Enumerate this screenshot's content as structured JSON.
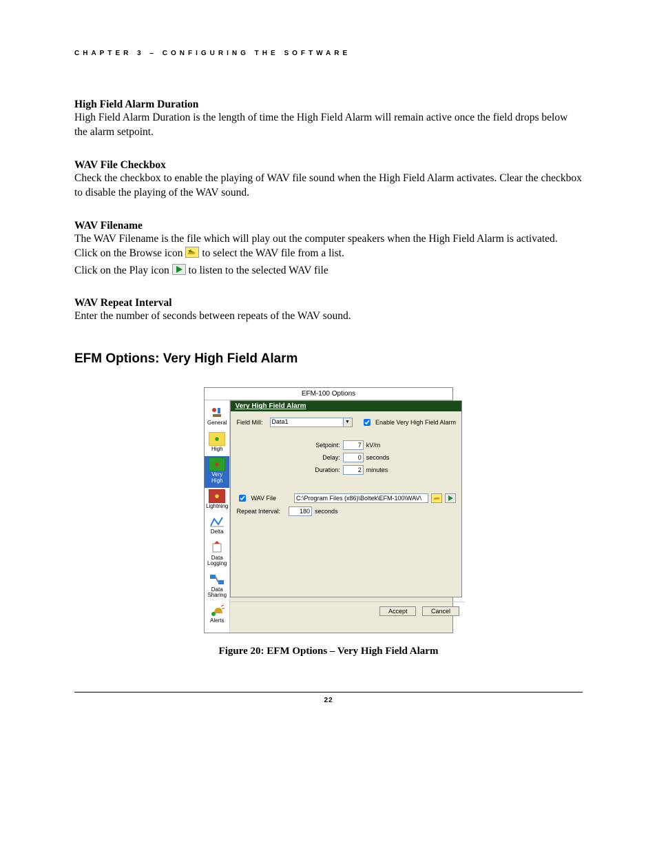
{
  "running_head": "CHAPTER 3 – CONFIGURING THE SOFTWARE",
  "s1": {
    "title": "High Field Alarm Duration",
    "body": "High Field Alarm Duration is the length of time the High Field Alarm will remain active once the field drops below the alarm setpoint."
  },
  "s2": {
    "title": "WAV File Checkbox",
    "body": "Check the checkbox to enable the playing of WAV file sound when the High Field Alarm activates. Clear the checkbox to disable the playing of the WAV sound."
  },
  "s3": {
    "title": "WAV Filename",
    "body_a": "The WAV Filename is the file which will play out the computer speakers when the High Field Alarm is activated.  Click on the Browse icon ",
    "body_b": " to select the WAV file from a list.",
    "body_c": "Click on the Play icon ",
    "body_d": " to listen to the selected WAV file"
  },
  "s4": {
    "title": "WAV Repeat Interval",
    "body": "Enter the number of seconds between repeats of the WAV sound."
  },
  "h2": "EFM Options: Very High Field Alarm",
  "dialog": {
    "title": "EFM-100 Options",
    "nav": {
      "general": "General",
      "high": "High",
      "very_high": "Very High",
      "lightning": "Lightning",
      "delta": "Delta",
      "data_logging": "Data Logging",
      "data_sharing": "Data Sharing",
      "alerts": "Alerts"
    },
    "panel": {
      "title": "Very High Field Alarm",
      "field_mill_label": "Field Mill:",
      "field_mill_value": "Data1",
      "enable_label": "Enable Very High Field Alarm",
      "setpoint_label": "Setpoint:",
      "setpoint_value": "7",
      "setpoint_unit": "kV/m",
      "delay_label": "Delay:",
      "delay_value": "0",
      "delay_unit": "seconds",
      "duration_label": "Duration:",
      "duration_value": "2",
      "duration_unit": "minutes",
      "wav_file_label": "WAV File",
      "wav_path": "C:\\Program Files (x86)\\Boltek\\EFM-100\\WAV\\",
      "repeat_label": "Repeat Interval:",
      "repeat_value": "180",
      "repeat_unit": "seconds"
    },
    "buttons": {
      "accept": "Accept",
      "cancel": "Cancel"
    }
  },
  "figure_caption": "Figure 20:  EFM Options – Very High Field Alarm",
  "page_number": "22"
}
